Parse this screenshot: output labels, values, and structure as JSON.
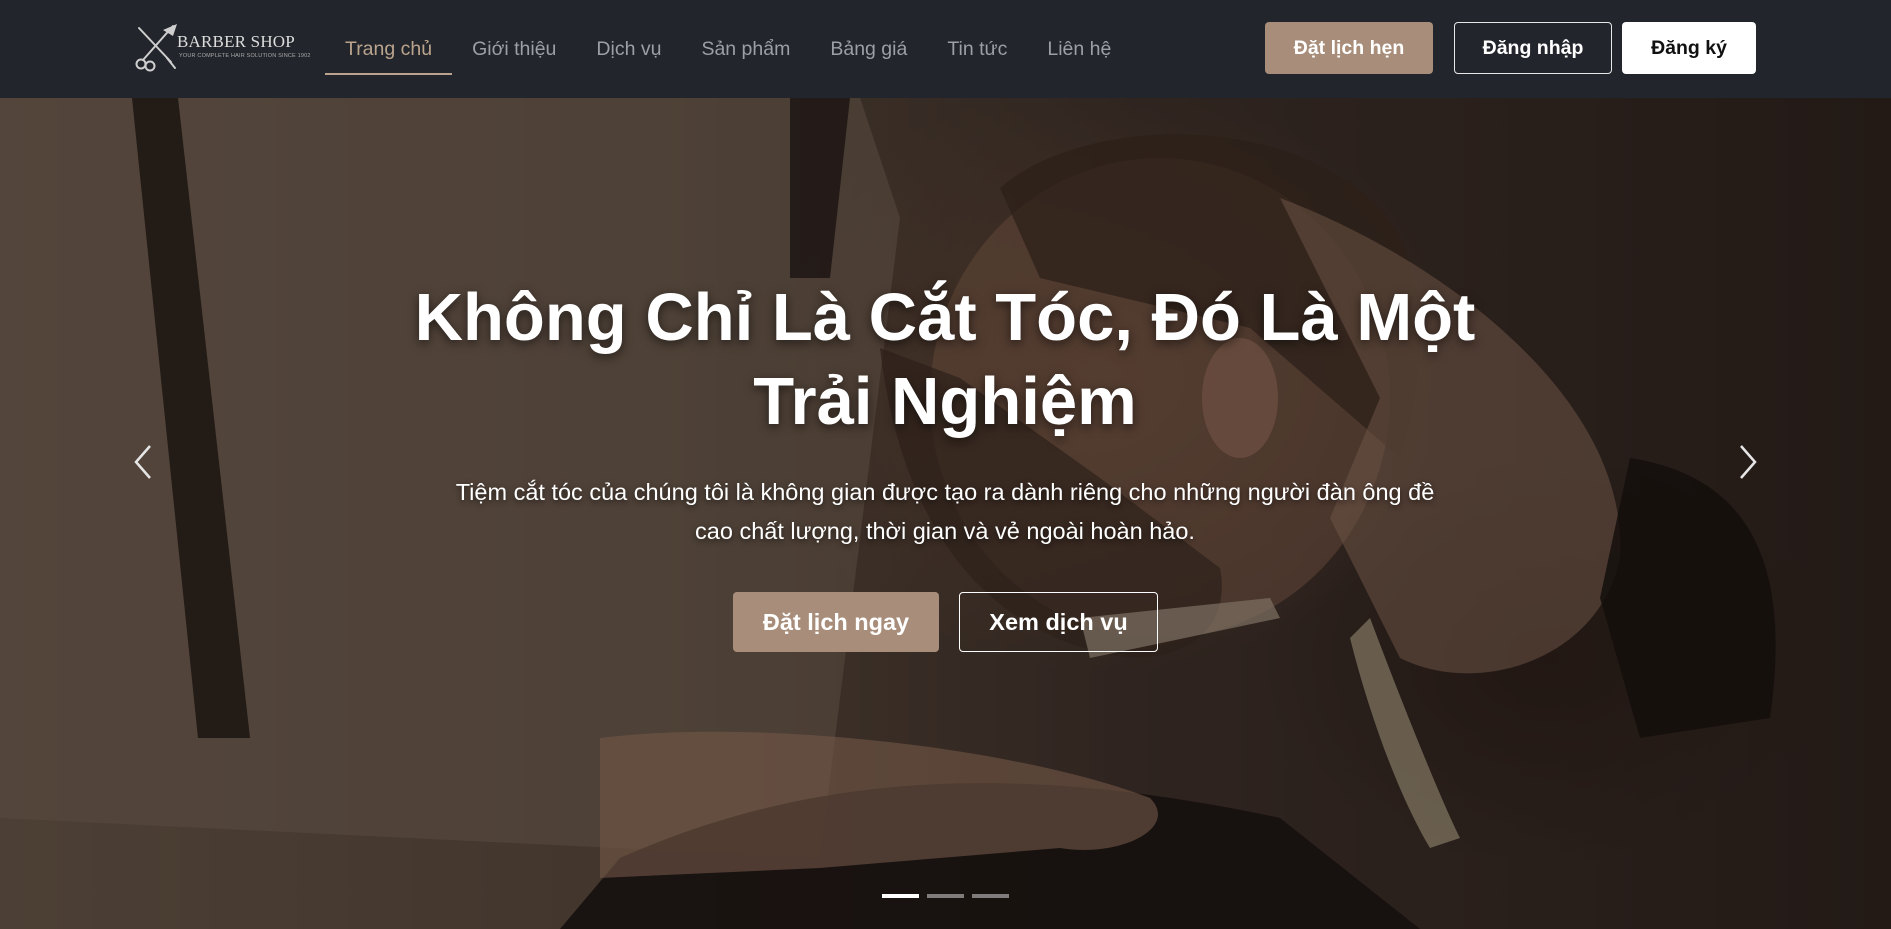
{
  "header": {
    "logo": {
      "title": "BARBER SHOP",
      "tagline": "YOUR COMPLETE HAIR SOLUTION SINCE 1902",
      "icon": "scissors-razor-icon"
    },
    "nav": [
      {
        "label": "Trang chủ",
        "active": true
      },
      {
        "label": "Giới thiệu",
        "active": false
      },
      {
        "label": "Dịch vụ",
        "active": false
      },
      {
        "label": "Sản phẩm",
        "active": false
      },
      {
        "label": "Bảng giá",
        "active": false
      },
      {
        "label": "Tin tức",
        "active": false
      },
      {
        "label": "Liên hệ",
        "active": false
      }
    ],
    "book_label": "Đặt lịch hẹn",
    "login_label": "Đăng nhập",
    "register_label": "Đăng ký"
  },
  "hero": {
    "title": "Không Chỉ Là Cắt Tóc, Đó Là Một Trải Nghiệm",
    "subtitle": "Tiệm cắt tóc của chúng tôi là không gian được tạo ra dành riêng cho những người đàn ông đề cao chất lượng, thời gian và vẻ ngoài hoàn hảo.",
    "primary_cta": "Đặt lịch ngay",
    "secondary_cta": "Xem dịch vụ",
    "prev_icon": "chevron-left-icon",
    "next_icon": "chevron-right-icon",
    "slides_total": 3,
    "active_slide": 1
  },
  "colors": {
    "header_bg": "#22252b",
    "accent": "#bba48e",
    "button_accent": "#a88e7a",
    "nav_text": "#9c9fa6"
  }
}
